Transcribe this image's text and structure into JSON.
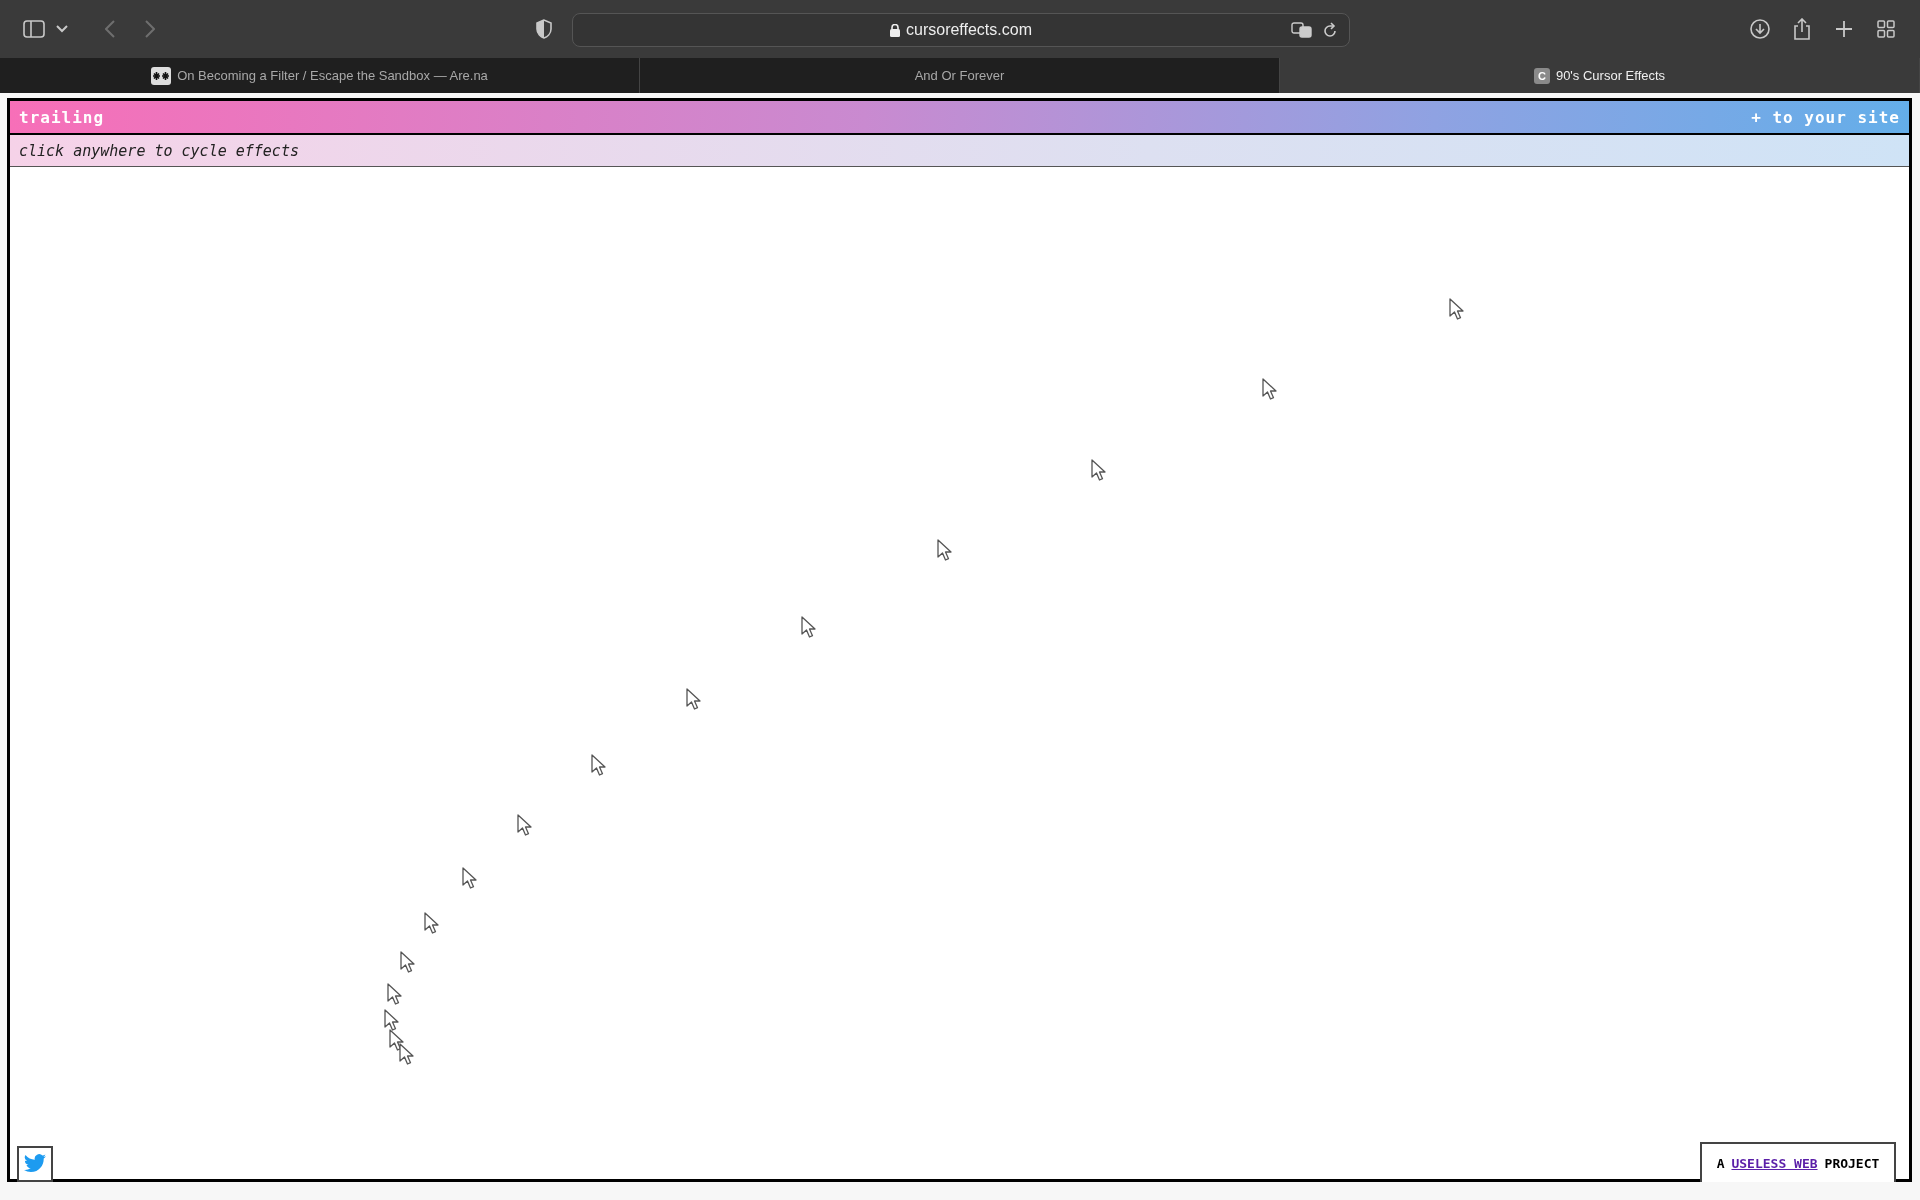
{
  "browser": {
    "address": "cursoreffects.com"
  },
  "tabs": [
    {
      "title": "On Becoming a Filter / Escape the Sandbox — Are.na",
      "kind": "asterisks",
      "selected": false
    },
    {
      "title": "And Or Forever",
      "kind": "plain",
      "selected": false
    },
    {
      "title": "90's Cursor Effects",
      "kind": "letter",
      "favicon_letter": "C",
      "selected": true
    }
  ],
  "page": {
    "effect_name": "trailing",
    "add_link": "+ to your site",
    "hint": "click anywhere to cycle effects",
    "footer": {
      "prefix": "A",
      "link": "USELESS WEB",
      "suffix": "PROJECT"
    }
  }
}
